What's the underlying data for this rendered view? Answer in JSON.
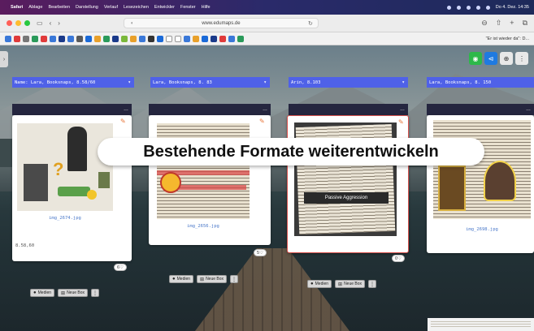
{
  "menubar": {
    "app": "Safari",
    "items": [
      "Ablage",
      "Bearbeiten",
      "Darstellung",
      "Verlauf",
      "Lesezeichen",
      "Entwickler",
      "Fenster",
      "Hilfe"
    ],
    "clock": "Do 4. Dez. 14:35"
  },
  "browser": {
    "url": "www.edumaps.de",
    "favorites_text": "\"Er ist wieder da\": D..."
  },
  "columns": [
    {
      "header": "Name: Lara, Booksnaps, 8.58/60",
      "caption": "img_2674.jpg",
      "meta": "8.58,60",
      "likes": "6",
      "buttons": {
        "medien": "Medien",
        "neue_box": "Neue Box"
      }
    },
    {
      "header": "Lara, Booksnaps, 8. 83",
      "caption": "img_2656.jpg",
      "likes": "5",
      "buttons": {
        "medien": "Medien",
        "neue_box": "Neue Box"
      }
    },
    {
      "header": "Arin, 8.103",
      "photo_label": "Passive Aggression",
      "likes": "0",
      "buttons": {
        "medien": "Medien",
        "neue_box": "Neue Box"
      }
    },
    {
      "header": "Lara, Booksnaps, 8. 150",
      "caption": "img_2698.jpg"
    }
  ],
  "banner": "Bestehende Formate weiterentwickeln",
  "colors": {
    "header_blue": "#4f61e8",
    "strip_dark": "#25263f",
    "edit_orange": "#e8763a",
    "eye_green": "#2db84a",
    "vs_blue": "#1f7ae0"
  }
}
